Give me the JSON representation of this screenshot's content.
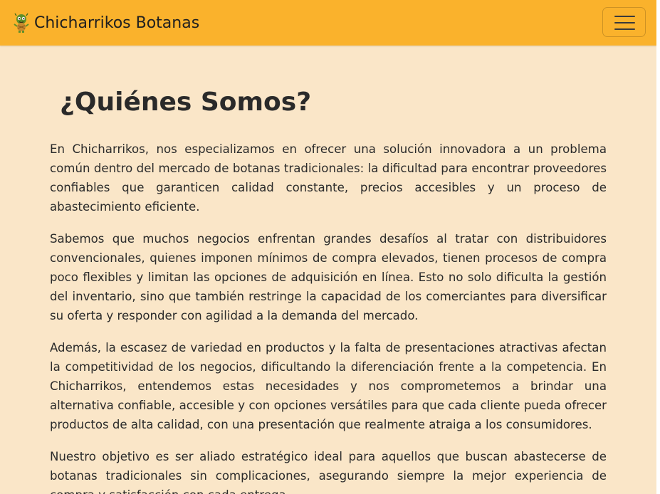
{
  "navbar": {
    "brand_text": "Chicharrikos Botanas",
    "brand_logo_icon": "chicharron-mascot-icon",
    "menu_icon": "hamburger-menu-icon",
    "background_color": "#fab22c"
  },
  "page": {
    "background_color": "#fae6c8"
  },
  "about": {
    "title": "¿Quiénes Somos?",
    "paragraphs": [
      "En Chicharrikos, nos especializamos en ofrecer una solución innovadora a un problema común dentro del mercado de botanas tradicionales: la dificultad para encontrar proveedores confiables que garanticen calidad constante, precios accesibles y un proceso de abastecimiento eficiente.",
      "Sabemos que muchos negocios enfrentan grandes desafíos al tratar con distribuidores convencionales, quienes imponen mínimos de compra elevados, tienen procesos de compra poco flexibles y limitan las opciones de adquisición en línea. Esto no solo dificulta la gestión del inventario, sino que también restringe la capacidad de los comerciantes para diversificar su oferta y responder con agilidad a la demanda del mercado.",
      "Además, la escasez de variedad en productos y la falta de presentaciones atractivas afectan la competitividad de los negocios, dificultando la diferenciación frente a la competencia. En Chicharrikos, entendemos estas necesidades y nos comprometemos a brindar una alternativa confiable, accesible y con opciones versátiles para que cada cliente pueda ofrecer productos de alta calidad, con una presentación que realmente atraiga a los consumidores.",
      "Nuestro objetivo es ser aliado estratégico ideal para aquellos que buscan abastecerse de botanas tradicionales sin complicaciones, asegurando siempre la mejor experiencia de compra y satisfacción con cada entrega."
    ]
  }
}
